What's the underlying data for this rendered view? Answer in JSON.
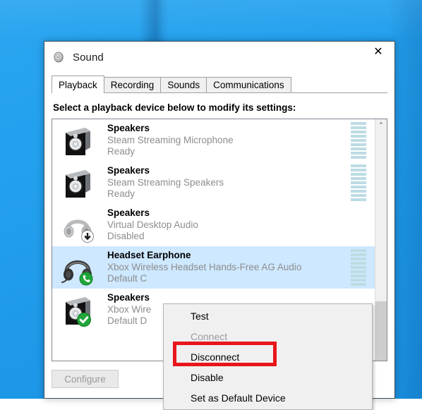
{
  "window": {
    "title": "Sound",
    "icon": "speaker-icon",
    "close_label": "✕"
  },
  "tabs": [
    {
      "label": "Playback",
      "active": true
    },
    {
      "label": "Recording",
      "active": false
    },
    {
      "label": "Sounds",
      "active": false
    },
    {
      "label": "Communications",
      "active": false
    }
  ],
  "instruction": "Select a playback device below to modify its settings:",
  "devices": [
    {
      "name": "Speakers",
      "description": "Steam Streaming Microphone",
      "status": "Ready",
      "icon": "speaker-box-icon",
      "badge": "none",
      "selected": false,
      "meter_segments": 9
    },
    {
      "name": "Speakers",
      "description": "Steam Streaming Speakers",
      "status": "Ready",
      "icon": "speaker-box-icon",
      "badge": "none",
      "selected": false,
      "meter_segments": 9
    },
    {
      "name": "Speakers",
      "description": "Virtual Desktop Audio",
      "status": "Disabled",
      "icon": "headphones-icon",
      "badge": "down-arrow-badge",
      "selected": false,
      "meter_segments": 0
    },
    {
      "name": "Headset Earphone",
      "description": "Xbox Wireless Headset Hands-Free AG Audio",
      "status": "Default C",
      "icon": "headset-icon",
      "badge": "green-phone-badge",
      "selected": true,
      "meter_segments": 9
    },
    {
      "name": "Speakers",
      "description": "Xbox Wire",
      "status": "Default D",
      "icon": "speaker-box-icon",
      "badge": "green-check-badge",
      "selected": false,
      "meter_segments": 0
    }
  ],
  "scrollbar": {
    "up_arrow": "⌃"
  },
  "footer": {
    "configure_label": "Configure",
    "configure_disabled": true
  },
  "context_menu": {
    "items": [
      {
        "label": "Test",
        "disabled": false,
        "highlighted": false
      },
      {
        "label": "Connect",
        "disabled": true,
        "highlighted": false
      },
      {
        "label": "Disconnect",
        "disabled": false,
        "highlighted": true
      },
      {
        "label": "Disable",
        "disabled": false,
        "highlighted": false
      },
      {
        "label": "Set as Default Device",
        "disabled": false,
        "highlighted": false
      }
    ]
  },
  "annotation": {
    "color": "#e8161b",
    "target": "Disconnect"
  }
}
